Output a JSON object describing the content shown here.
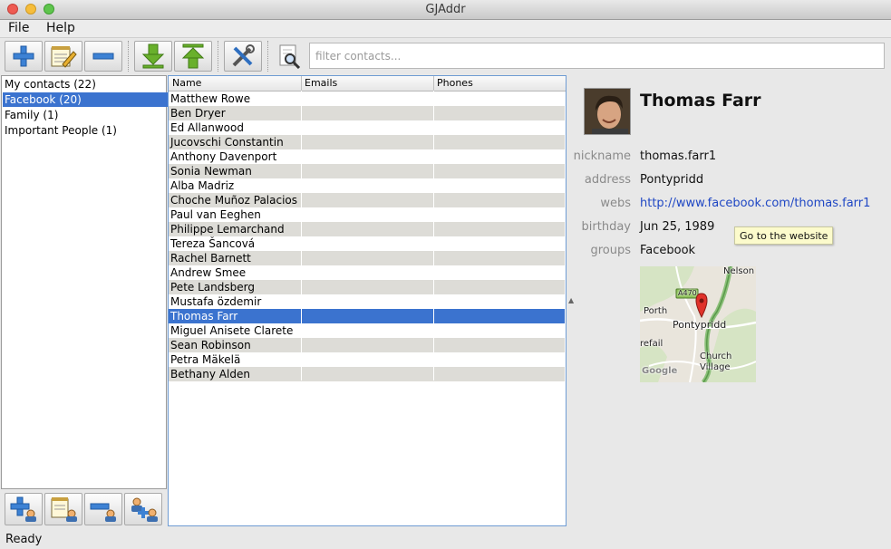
{
  "window": {
    "title": "GJAddr"
  },
  "menu": {
    "file": "File",
    "help": "Help"
  },
  "toolbar": {
    "filter_placeholder": "filter contacts..."
  },
  "groups": [
    {
      "label": "My contacts (22)",
      "selected": false
    },
    {
      "label": "Facebook (20)",
      "selected": true
    },
    {
      "label": "Family (1)",
      "selected": false
    },
    {
      "label": "Important People (1)",
      "selected": false
    }
  ],
  "table": {
    "columns": [
      "Name",
      "Emails",
      "Phones"
    ],
    "rows": [
      {
        "name": "Matthew Rowe",
        "emails": "",
        "phones": ""
      },
      {
        "name": "Ben Dryer",
        "emails": "",
        "phones": ""
      },
      {
        "name": "Ed Allanwood",
        "emails": "",
        "phones": ""
      },
      {
        "name": "Jucovschi Constantin",
        "emails": "",
        "phones": ""
      },
      {
        "name": "Anthony Davenport",
        "emails": "",
        "phones": ""
      },
      {
        "name": "Sonia Newman",
        "emails": "",
        "phones": ""
      },
      {
        "name": "Alba Madriz",
        "emails": "",
        "phones": ""
      },
      {
        "name": "Choche Muñoz Palacios",
        "emails": "",
        "phones": ""
      },
      {
        "name": "Paul van Eeghen",
        "emails": "",
        "phones": ""
      },
      {
        "name": "Philippe Lemarchand",
        "emails": "",
        "phones": ""
      },
      {
        "name": "Tereza Šancová",
        "emails": "",
        "phones": ""
      },
      {
        "name": "Rachel Barnett",
        "emails": "",
        "phones": ""
      },
      {
        "name": "Andrew Smee",
        "emails": "",
        "phones": ""
      },
      {
        "name": "Pete Landsberg",
        "emails": "",
        "phones": ""
      },
      {
        "name": "Mustafa özdemir",
        "emails": "",
        "phones": ""
      },
      {
        "name": "Thomas Farr",
        "emails": "",
        "phones": ""
      },
      {
        "name": "Miguel Anisete Clarete",
        "emails": "",
        "phones": ""
      },
      {
        "name": "Sean Robinson",
        "emails": "",
        "phones": ""
      },
      {
        "name": "Petra Mäkelä",
        "emails": "",
        "phones": ""
      },
      {
        "name": "Bethany Alden",
        "emails": "",
        "phones": ""
      }
    ],
    "selected_index": 15
  },
  "details": {
    "name": "Thomas Farr",
    "nickname_label": "nickname",
    "nickname": "thomas.farr1",
    "address_label": "address",
    "address": "Pontypridd",
    "webs_label": "webs",
    "webs": "http://www.facebook.com/thomas.farr1",
    "birthday_label": "birthday",
    "birthday": "Jun 25, 1989",
    "groups_label": "groups",
    "groups": "Facebook",
    "tooltip": "Go to the website"
  },
  "map": {
    "labels": {
      "nelson": "Nelson",
      "road": "A470",
      "porth": "Porth",
      "pontypridd": "Pontypridd",
      "refail": "refail",
      "church": "Church",
      "village": "Village",
      "google": "Google"
    }
  },
  "status": "Ready",
  "colors": {
    "selection": "#3b73cf",
    "link": "#1f47c4",
    "alt_row": "#dddcd7",
    "tooltip_bg": "#fcfbcc"
  }
}
